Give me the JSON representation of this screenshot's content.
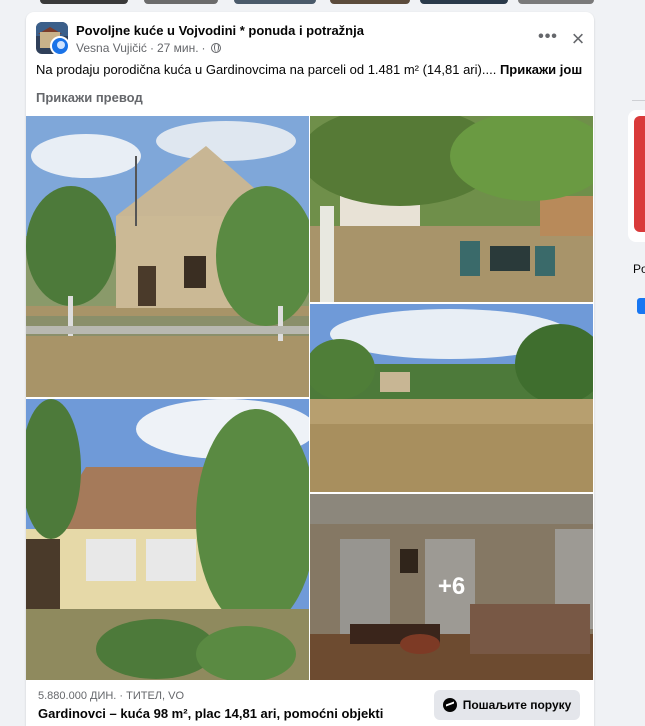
{
  "post": {
    "group_name": "Povoljne kuće u Vojvodini * ponuda i potražnja",
    "author": "Vesna Vujičić",
    "separator": "·",
    "time": "27 мин.",
    "separator2": "·",
    "text": "Na prodaju porodična kuća u Gardinovcima na parceli od 1.481 m² (14,81 ari)....",
    "see_more": "Прикажи још",
    "see_translation": "Прикажи превод",
    "more_photos": "+6"
  },
  "listing": {
    "price_meta": "5.880.000 ДИН. · ТИТЕЛ, VO",
    "title": "Gardinovci – kuća 98 m², plac 14,81 ari, pomoćni objekti",
    "send_message": "Пошаљите поруку"
  },
  "right_panel": {
    "label": "Po"
  },
  "icons": {
    "more": "more-options-icon",
    "close": "close-icon",
    "privacy": "globe-icon",
    "messenger": "messenger-icon"
  },
  "colors": {
    "background": "#f0f2f5",
    "card": "#ffffff",
    "secondary_text": "#65676b",
    "button": "#e4e6eb",
    "accent": "#1877f2"
  }
}
